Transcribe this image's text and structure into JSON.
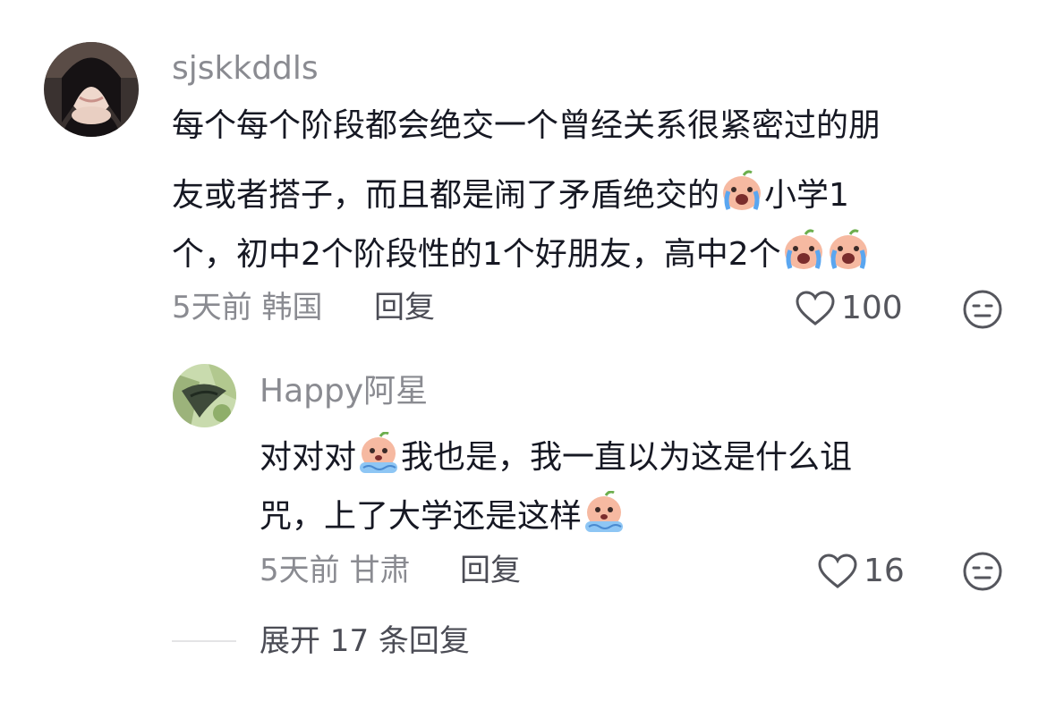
{
  "comment": {
    "username": "sjskkddls",
    "lines": [
      [
        "每个每个阶段都会绝交一个曾经关系很紧密过的朋"
      ],
      [
        "友或者搭子，而且都是闹了矛盾绝交的",
        "小学1"
      ],
      [
        "个，初中2个阶段性的1个好朋友，高中2个"
      ]
    ],
    "time": "5天前",
    "location": "韩国",
    "reply_label": "回复",
    "likes": "100"
  },
  "reply": {
    "username": "Happy阿星",
    "lines": [
      [
        "对对对",
        "我也是，我一直以为这是什么诅"
      ],
      [
        "咒，上了大学还是这样"
      ]
    ],
    "time": "5天前",
    "location": "甘肃",
    "reply_label": "回复",
    "likes": "16"
  },
  "expand_label": "展开 17 条回复",
  "icons": {
    "like": "heart-outline-icon",
    "dislike": "neutral-face-icon",
    "emoji_cry": "crying-face-emoji",
    "emoji_sweat": "nervous-face-emoji"
  }
}
